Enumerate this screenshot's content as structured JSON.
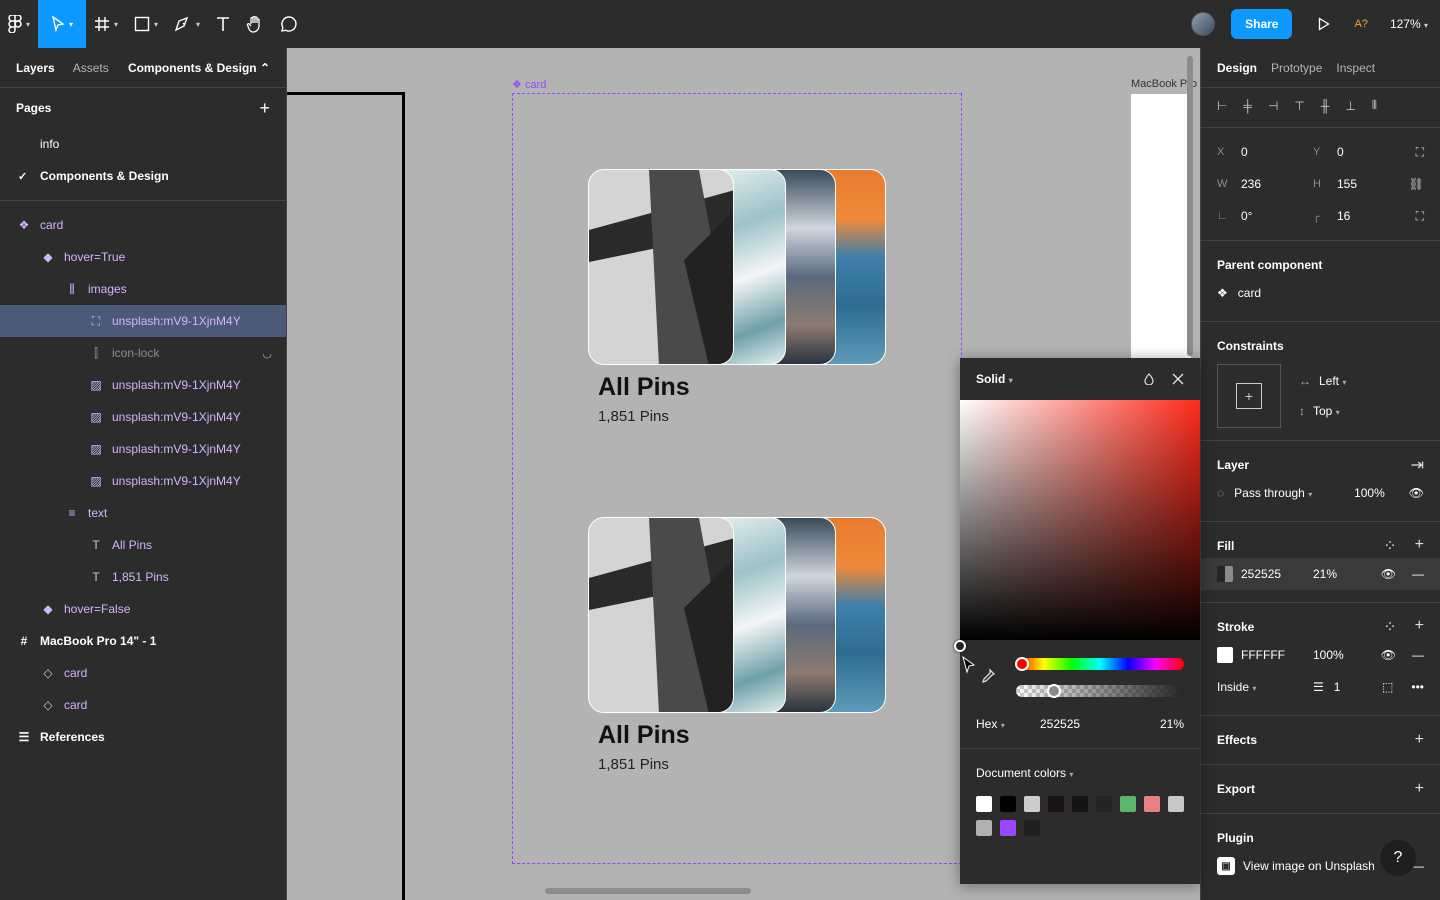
{
  "toolbar": {
    "share_label": "Share",
    "badge": "A?",
    "zoom": "127%"
  },
  "left_panel": {
    "tabs": [
      "Layers",
      "Assets"
    ],
    "page_select": "Components & Design ⌃",
    "pages_title": "Pages",
    "pages": [
      "info",
      "Components & Design"
    ],
    "layers": [
      {
        "label": "card",
        "indent": 16,
        "icon": "component-icon",
        "style": "purple"
      },
      {
        "label": "hover=True",
        "indent": 40,
        "icon": "variant-icon",
        "style": "purple"
      },
      {
        "label": "images",
        "indent": 64,
        "icon": "auto-layout-icon",
        "style": "purple"
      },
      {
        "label": "unsplash:mV9-1XjnM4Y",
        "indent": 88,
        "icon": "frame-icon",
        "style": "purple selected"
      },
      {
        "label": "icon-lock",
        "indent": 88,
        "icon": "instance-frame-icon",
        "style": "dim",
        "hidden": true
      },
      {
        "label": "unsplash:mV9-1XjnM4Y",
        "indent": 88,
        "icon": "image-icon",
        "style": "purple"
      },
      {
        "label": "unsplash:mV9-1XjnM4Y",
        "indent": 88,
        "icon": "image-icon",
        "style": "purple"
      },
      {
        "label": "unsplash:mV9-1XjnM4Y",
        "indent": 88,
        "icon": "image-icon",
        "style": "purple"
      },
      {
        "label": "unsplash:mV9-1XjnM4Y",
        "indent": 88,
        "icon": "image-icon",
        "style": "purple"
      },
      {
        "label": "text",
        "indent": 64,
        "icon": "text-layout-icon",
        "style": "purple"
      },
      {
        "label": "All Pins",
        "indent": 88,
        "icon": "text-icon",
        "style": "purple"
      },
      {
        "label": "1,851 Pins",
        "indent": 88,
        "icon": "text-icon",
        "style": "purple"
      },
      {
        "label": "hover=False",
        "indent": 40,
        "icon": "variant-icon",
        "style": "purple"
      },
      {
        "label": "MacBook Pro 14\" - 1",
        "indent": 16,
        "icon": "frame-hash-icon",
        "style": "bold"
      },
      {
        "label": "card",
        "indent": 40,
        "icon": "instance-icon",
        "style": "purple"
      },
      {
        "label": "card",
        "indent": 40,
        "icon": "instance-icon",
        "style": "purple"
      },
      {
        "label": "References",
        "indent": 16,
        "icon": "section-icon",
        "style": "bold"
      }
    ]
  },
  "canvas": {
    "component_label": "card",
    "macbook_label": "MacBook Pro",
    "cards": [
      {
        "title": "All Pins",
        "count": "1,851 Pins"
      },
      {
        "title": "All Pins",
        "count": "1,851 Pins"
      }
    ]
  },
  "color_picker": {
    "mode": "Solid",
    "format": "Hex",
    "hex": "252525",
    "opacity": "21%",
    "doc_colors_title": "Document colors",
    "swatches": [
      "#ffffff",
      "#000000",
      "#cccccc",
      "#1a1414",
      "#141414",
      "#252525",
      "#5ab86c",
      "#e88080",
      "#c8c8c8",
      "#b3b3b3",
      "#9747ff",
      "#1e1e1e"
    ]
  },
  "right_panel": {
    "tabs": [
      "Design",
      "Prototype",
      "Inspect"
    ],
    "x": "0",
    "y": "0",
    "w": "236",
    "h": "155",
    "rotation": "0°",
    "radius": "16",
    "parent_component_title": "Parent component",
    "parent_component": "card",
    "constraints_title": "Constraints",
    "constraint_h": "Left",
    "constraint_v": "Top",
    "layer_title": "Layer",
    "blend": "Pass through",
    "layer_opacity": "100%",
    "fill_title": "Fill",
    "fill_hex": "252525",
    "fill_opacity": "21%",
    "stroke_title": "Stroke",
    "stroke_hex": "FFFFFF",
    "stroke_opacity": "100%",
    "stroke_position": "Inside",
    "stroke_weight": "1",
    "effects_title": "Effects",
    "export_title": "Export",
    "plugin_title": "Plugin",
    "plugin_action": "View image on Unsplash",
    "help": "?"
  }
}
